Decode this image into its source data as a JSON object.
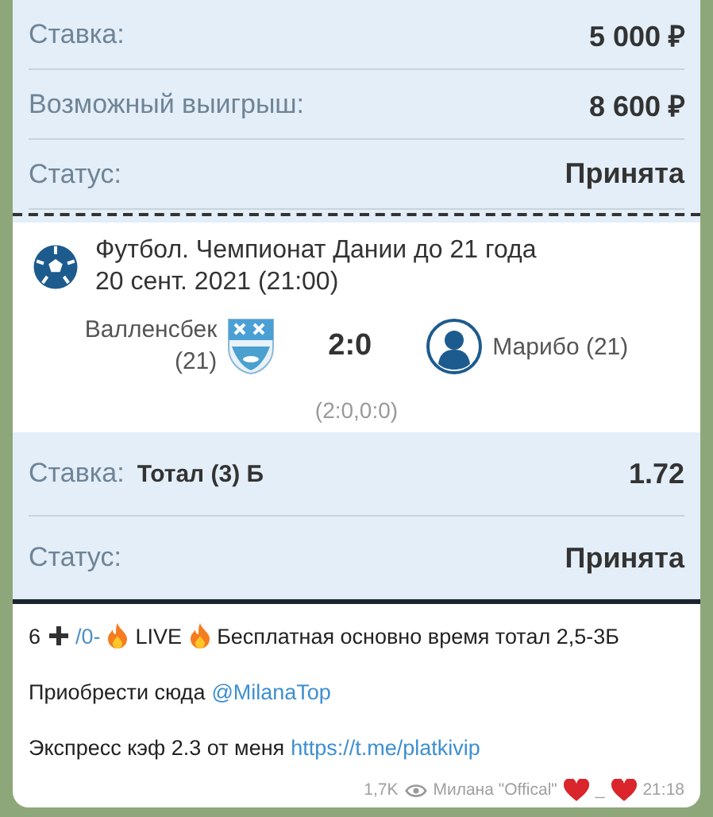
{
  "bet_summary": [
    {
      "label": "Ставка:",
      "value": "5 000 ₽"
    },
    {
      "label": "Возможный выигрыш:",
      "value": "8 600 ₽"
    },
    {
      "label": "Статус:",
      "value": "Принята"
    }
  ],
  "event": {
    "title": "Футбол. Чемпионат Дании до 21 года",
    "date": "20 сент. 2021 (21:00)",
    "home": "Валленсбек",
    "home_age": "(21)",
    "score": "2:0",
    "away": "Марибо (21)",
    "periods": "(2:0,0:0)"
  },
  "bet_detail": [
    {
      "label": "Ставка:",
      "market": "Тотал (3) Б",
      "value": "1.72"
    },
    {
      "label": "Статус:",
      "value": "Принята"
    }
  ],
  "message": {
    "line1": {
      "count": "6",
      "tag": "/0-",
      "live": "LIVE",
      "text": "Бесплатная основно время тотал 2,5-3Б"
    },
    "line2": {
      "text": "Приобрести сюда",
      "link": "@MilanaTop"
    },
    "line3": {
      "text": "Экспресс кэф 2.3 от меня",
      "link": "https://t.me/platkivip"
    },
    "views": "1,7K",
    "author": "Милана \"Offical\"",
    "author_sep": "_",
    "time": "21:18"
  }
}
